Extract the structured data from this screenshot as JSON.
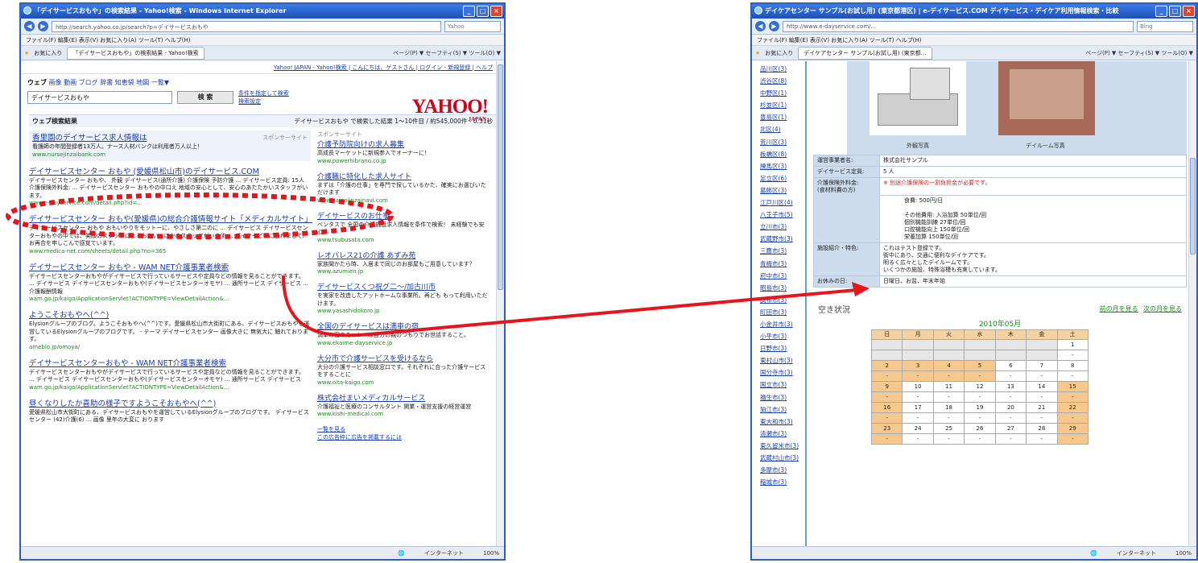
{
  "left_window": {
    "title": "「デイサービスおもや」の検索結果 - Yahoo!検索 - Windows Internet Explorer",
    "address": "http://search.yahoo.co.jp/search?p=デイサービスおもや",
    "search_box": "Yahoo",
    "menu": "ファイル(F)  編集(E)  表示(V)  お気に入り(A)  ツール(T)  ヘルプ(H)",
    "fav_label": "お気に入り",
    "fav_tab": "「デイサービスおもや」の検索結果 - Yahoo!検索",
    "tools": "ページ(P) ▼  セーフティ(S) ▼  ツール(O) ▼",
    "status_zone": "インターネット",
    "zoom": "100%",
    "yahoo": {
      "top_links": "Yahoo! JAPAN - Yahoo!検索 | こんにちは、ゲストさん | ログイン - 新規登録 | ヘルプ",
      "tabs": [
        "ウェブ",
        "画像",
        "動画",
        "ブログ",
        "辞書",
        "知恵袋",
        "地図",
        "一覧▼"
      ],
      "query": "デイサービスおもや",
      "search_button": "検 索",
      "opt1": "条件を指定して検索",
      "opt2": "検索設定",
      "logo": "YAHOO!",
      "logo_sub": "JAPAN",
      "results_label": "ウェブ検索結果",
      "results_count": "デイサービスおもや で検索した結果 1～10件目 / 約545,000件 - 0.31秒",
      "sponsor_label": "スポンサーサイト",
      "sponsor": {
        "title": "香里園のデイサービス求人情報は",
        "snippet": "看護師の年間登録者13万人。ナース人材バンクは利用者万人以上！",
        "url": "www.nursejinzaibank.com"
      },
      "results": [
        {
          "title": "デイサービスセンター おもや (愛媛県松山市)のデイサービス.COM",
          "snippet": "デイサービスセンター おもや、 外観 デイサービス(通所介護) 介護保険 予防介護 ... デイサービス定員: 15人 介護保険外料金: ... デイサービスセンター おもやの中口え 地域の安心として、安心のあたたかいスタッフがいます。",
          "url": "www.e-dayservice.com/detail.php?id=..."
        },
        {
          "title": "デイサービスセンター おもや(愛媛県)の総合介護情報サイト「メディカルサイト」",
          "snippet": "デイサービスセンター おもや おもいやりをモットーに、やさしさ第二のに ... デイサービス デイサービスセンターおもやの中では、笑顔のスタッフによるおもい。ほかのスタッフがいます ... デイサービスに通れまして、お再合を申しこんで感覚ています。",
          "url": "www.medica-net.com/sheets/detail.php?no=365"
        },
        {
          "title": "デイサービスセンター おもや - WAM NET介護事業者検索",
          "snippet": "デイサービスセンターおもやがデイサービスで行っているサービスや定員などの情報を見ることができます。 ... デイサービス デイサービスセンターおもや(デイサービスセンターオモヤ) ... 通所サービス デイサービス ... 介護報酬情報",
          "url": "wam.go.jp/kaigo/ApplicationServlet?ACTIONTYPE=ViewDetailAction&..."
        },
        {
          "title": "ようこそおもやへ(^^)",
          "snippet": "Elysionグループのブログ。ようこそおもやへ(^^)です。愛媛県松山市大街町にある、デイサービスおもやを運営しているElysionグループのブログです。 - テーマ デイサービスセンター 画像大きに 無気大に 触れております。",
          "url": "ameblo.jp/omoya/"
        },
        {
          "title": "デイサービスセンターおもや - WAM NET介護事業者検索",
          "snippet": "デイサービスセンターおもやがデイサービスで行っているサービスや定員などの情報を見ることができます。 ... デイサービス デイサービスセンターおもや(デイサービスセンターオモヤ) ... 通所サービス デイサービス",
          "url": "wam.go.jp/kaigo/ApplicationServlet?ACTIONTYPE=ViewDetailAction&..."
        },
        {
          "title": "昼くなりしたか喜助の様子ですようこそおもやへ(^^)",
          "snippet": "愛媛県松山市大街町にある、デイサービスおもやを運営しているElysionグループのブログです。 デイサービスセンター (42)介護(6) ... 画像 里年の大変に おります",
          "url": ""
        }
      ],
      "side_label": "スポンサーサイト",
      "side_ads": [
        {
          "title": "介護予防院向けの求人募集",
          "snippet": "高成長マーケットに新規参入でオーナーに！",
          "url": "www.powerhibrano.co.jp"
        },
        {
          "title": "介護職に特化した求人サイト",
          "snippet": "まずは「介護の仕事」を専門で探しているかた、確実にお選びいただけます",
          "url": "www.kaigojinzainavi.com"
        },
        {
          "title": "デイサービスのお仕事",
          "snippet": "ベンタスで 全国の介護施設求人情報を条件で検索！ 未経験でも安心",
          "url": "www.tsubusata.com"
        },
        {
          "title": "レオパレス21の介護 あずみ苑",
          "snippet": "家族聞かたら時、入居まで同じのお部屋もご用意しています？",
          "url": "www.azumien.jp"
        },
        {
          "title": "デイサービスくつ祝グ二〜/加古川市",
          "snippet": "を実家を改造したアットホームな事業所。再ども もって利用いただけます。",
          "url": "www.yasashidokoro.jp"
        },
        {
          "title": "全国のデイサービスは満車の宿",
          "snippet": "満車の宿のモットーは自分の親のつもりでお世話すること。",
          "url": "www.ekaime-dayservice.jp"
        },
        {
          "title": "大分市で介護サービスを受けるなら",
          "snippet": "大分の介護サービス相談窓口です。それぞれに合った介護サービスをすることに",
          "url": "www.oita-kaigo.com"
        },
        {
          "title": "株式会社まいメディカルサービス",
          "snippet": "介護福祉と医療のコンサルタント 開業・運営支援の経営運営",
          "url": "www.kishi-medical.com"
        }
      ],
      "side_more": [
        "一覧を見る",
        "この広告枠に広告を掲載するには"
      ]
    }
  },
  "right_window": {
    "title": "デイケアセンター サンプル(お試し用) (東京都港区) | e-デイサービス.COM デイサービス・デイケア利用情報検索・比較",
    "address": "http://www.e-dayservice.com/...",
    "search_box": "Bing",
    "menu": "ファイル(F)  編集(E)  表示(V)  お気に入り(A)  ツール(T)  ヘルプ(H)",
    "fav_label": "お気に入り",
    "fav_tab": "デイケアセンター サンプル(お試し用) (東京都…",
    "tools": "ページ(P) ▼  セーフティ(S) ▼  ツール(O) ▼",
    "status_zone": "インターネット",
    "zoom": "100%",
    "nav": [
      "品川区(3)",
      "渋谷区(8)",
      "中野区(1)",
      "杉並区(1)",
      "豊島区(1)",
      "北区(4)",
      "荒川区(3)",
      "板橋区(8)",
      "練馬区(3)",
      "足立区(6)",
      "葛飾区(3)",
      "江戸川区(4)",
      "八王子市(5)",
      "立川市(3)",
      "武蔵野市(3)",
      "三鷹市(3)",
      "青梅市(3)",
      "府中市(3)",
      "昭島市(3)",
      "調布市(3)",
      "町田市(3)",
      "小金井市(3)",
      "小平市(3)",
      "日野市(3)",
      "東村山市(3)",
      "国分寺市(3)",
      "国立市(3)",
      "福生市(3)",
      "狛江市(3)",
      "東大和市(3)",
      "清瀬市(3)",
      "東久留米市(3)",
      "武蔵村山市(3)",
      "多摩市(3)",
      "稲城市(3)"
    ],
    "photo_captions": [
      "外観写真",
      "デイルーム写真"
    ],
    "details": [
      {
        "label": "運営事業者名:",
        "value": "株式会社サンプル"
      },
      {
        "label": "デイサービス定員:",
        "value": "5 人"
      },
      {
        "label": "介護保険外料金:\n(食材料費の方)",
        "value": "※ 別途介護保険の一割負担金が必要です。"
      },
      {
        "label": "",
        "value": "食費:   500円/日"
      },
      {
        "label": "",
        "value": "その他費用:   入浴加算 50単位/回\n個別機能訓練 27単位/回\n口腔機能向上 150単位/回\n栄養加算 150単位/回"
      },
      {
        "label": "施設紹介・特色:",
        "value": "これはテスト登録です。\n街中にあり、交通に便利なデイケアです。\n明るく広々としたデイルームです。\nいくつかの施設、特殊浴槽も充実しています。"
      },
      {
        "label": "お休みの日:",
        "value": "日曜日、お盆、年末年始"
      }
    ],
    "calendar": {
      "title": "空き状況",
      "prev": "前の月を見る",
      "next": "次の月を見る",
      "month": "2010年05月",
      "days": [
        "日",
        "月",
        "火",
        "水",
        "木",
        "金",
        "土"
      ],
      "weeks": [
        [
          [
            "",
            ""
          ],
          [
            "",
            ""
          ],
          [
            "",
            ""
          ],
          [
            "",
            ""
          ],
          [
            "",
            ""
          ],
          [
            "",
            ""
          ],
          [
            "1",
            "-"
          ]
        ],
        [
          [
            "2",
            "-"
          ],
          [
            "3",
            "-"
          ],
          [
            "4",
            "-"
          ],
          [
            "5",
            "-"
          ],
          [
            "6",
            "-"
          ],
          [
            "7",
            "-"
          ],
          [
            "8",
            "-"
          ]
        ],
        [
          [
            "9",
            "-"
          ],
          [
            "10",
            "-"
          ],
          [
            "11",
            "-"
          ],
          [
            "12",
            "-"
          ],
          [
            "13",
            "-"
          ],
          [
            "14",
            "-"
          ],
          [
            "15",
            "-"
          ]
        ],
        [
          [
            "16",
            "-"
          ],
          [
            "17",
            "-"
          ],
          [
            "18",
            "-"
          ],
          [
            "19",
            "-"
          ],
          [
            "20",
            "-"
          ],
          [
            "21",
            "-"
          ],
          [
            "22",
            "-"
          ]
        ],
        [
          [
            "23",
            "-"
          ],
          [
            "24",
            "-"
          ],
          [
            "25",
            "-"
          ],
          [
            "26",
            "-"
          ],
          [
            "27",
            "-"
          ],
          [
            "28",
            "-"
          ],
          [
            "29",
            "-"
          ]
        ]
      ]
    }
  },
  "annotation": {
    "color": "#e8141b"
  }
}
